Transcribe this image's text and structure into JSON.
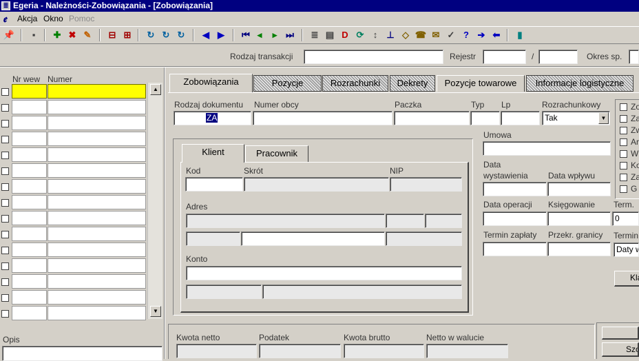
{
  "window": {
    "title": "Egeria - Należności-Zobowiązania - [Zobowiązania]"
  },
  "menu": {
    "items": [
      "Akcja",
      "Okno",
      "Pomoc"
    ]
  },
  "toolbar": {
    "icons": [
      "pin-icon",
      "save-icon",
      "add-icon",
      "delete-icon",
      "edit-icon",
      "split-icon",
      "merge-icon",
      "query-icon",
      "query-run-icon",
      "query-help-icon",
      "arrow-left-icon",
      "arrow-right-icon",
      "first-record-icon",
      "prev-record-icon",
      "next-record-icon",
      "last-record-icon",
      "report-icon",
      "print-icon",
      "pdf-icon",
      "refresh-icon",
      "sort-icon",
      "tree-icon",
      "clear-icon",
      "phone-icon",
      "email-icon",
      "wizard-icon",
      "help-icon",
      "forward-icon",
      "back-icon",
      "exit-door-icon"
    ],
    "glyphs": [
      "📌",
      "▪",
      "✚",
      "✖",
      "✎",
      "⊟",
      "⊞",
      "↻",
      "↻",
      "↻",
      "◀",
      "▶",
      "⏮",
      "◂",
      "▸",
      "⏭",
      "≣",
      "▤",
      "D",
      "⟳",
      "↕",
      "⊥",
      "◇",
      "☎",
      "✉",
      "✓",
      "?",
      "➔",
      "⬅",
      "▮"
    ]
  },
  "filter": {
    "rodzaj_label": "Rodzaj transakcji",
    "rodzaj_value": "",
    "rejestr_label": "Rejestr",
    "rejestr_value": "",
    "slash": "/",
    "rejestr2_value": "",
    "okres_label": "Okres sp.",
    "okres_value": ""
  },
  "list": {
    "col_nrwew": "Nr wew",
    "col_numer": "Numer",
    "rows": 15,
    "opis_label": "Opis",
    "opis_value": ""
  },
  "tabs": [
    "Zobowiązania",
    "Pozycje",
    "Rozrachunki",
    "Dekrety",
    "Pozycje towarowe",
    "Informacje logistyczne"
  ],
  "form": {
    "rodzaj_dok_label": "Rodzaj dokumentu",
    "rodzaj_dok_value": "ZA",
    "numer_obcy_label": "Numer obcy",
    "numer_obcy_value": "",
    "paczka_label": "Paczka",
    "paczka_value": "",
    "typ_label": "Typ",
    "typ_value": "",
    "lp_label": "Lp",
    "lp_value": "",
    "rozrach_label": "Rozrachunkowy",
    "rozrach_value": "Tak",
    "umowa_label": "Umowa",
    "umowa_value": "",
    "data_wyst_label1": "Data",
    "data_wyst_label2": "wystawienia",
    "data_wyst_value": "",
    "data_wplywu_label": "Data wpływu",
    "data_wplywu_value": "",
    "data_oper_label": "Data operacji",
    "data_oper_value": "",
    "ksiegowanie_label": "Księgowanie",
    "ksiegowanie_value": "",
    "term_label": "Term.",
    "term_value": "0",
    "termin_zap_label": "Termin zapłaty",
    "termin_zap_value": "",
    "przekr_label": "Przekr. granicy",
    "przekr_value": "",
    "termin2_label": "Termin",
    "termin2_value": "Daty w",
    "checkbox_letters": [
      "Zo",
      "Za",
      "Zw",
      "Ar",
      "Wi",
      "Ko",
      "Za",
      "G"
    ],
    "kla_button": "Kla",
    "szc_button": "Szc"
  },
  "subtabs": [
    "Klient",
    "Pracownik"
  ],
  "klient": {
    "kod_label": "Kod",
    "kod_value": "",
    "skrot_label": "Skrót",
    "skrot_value": "",
    "nip_label": "NIP",
    "nip_value": "",
    "adres_label": "Adres",
    "konto_label": "Konto",
    "konto_value": ""
  },
  "amounts": {
    "netto_label": "Kwota netto",
    "podatek_label": "Podatek",
    "brutto_label": "Kwota brutto",
    "walucie_label": "Netto w walucie"
  }
}
